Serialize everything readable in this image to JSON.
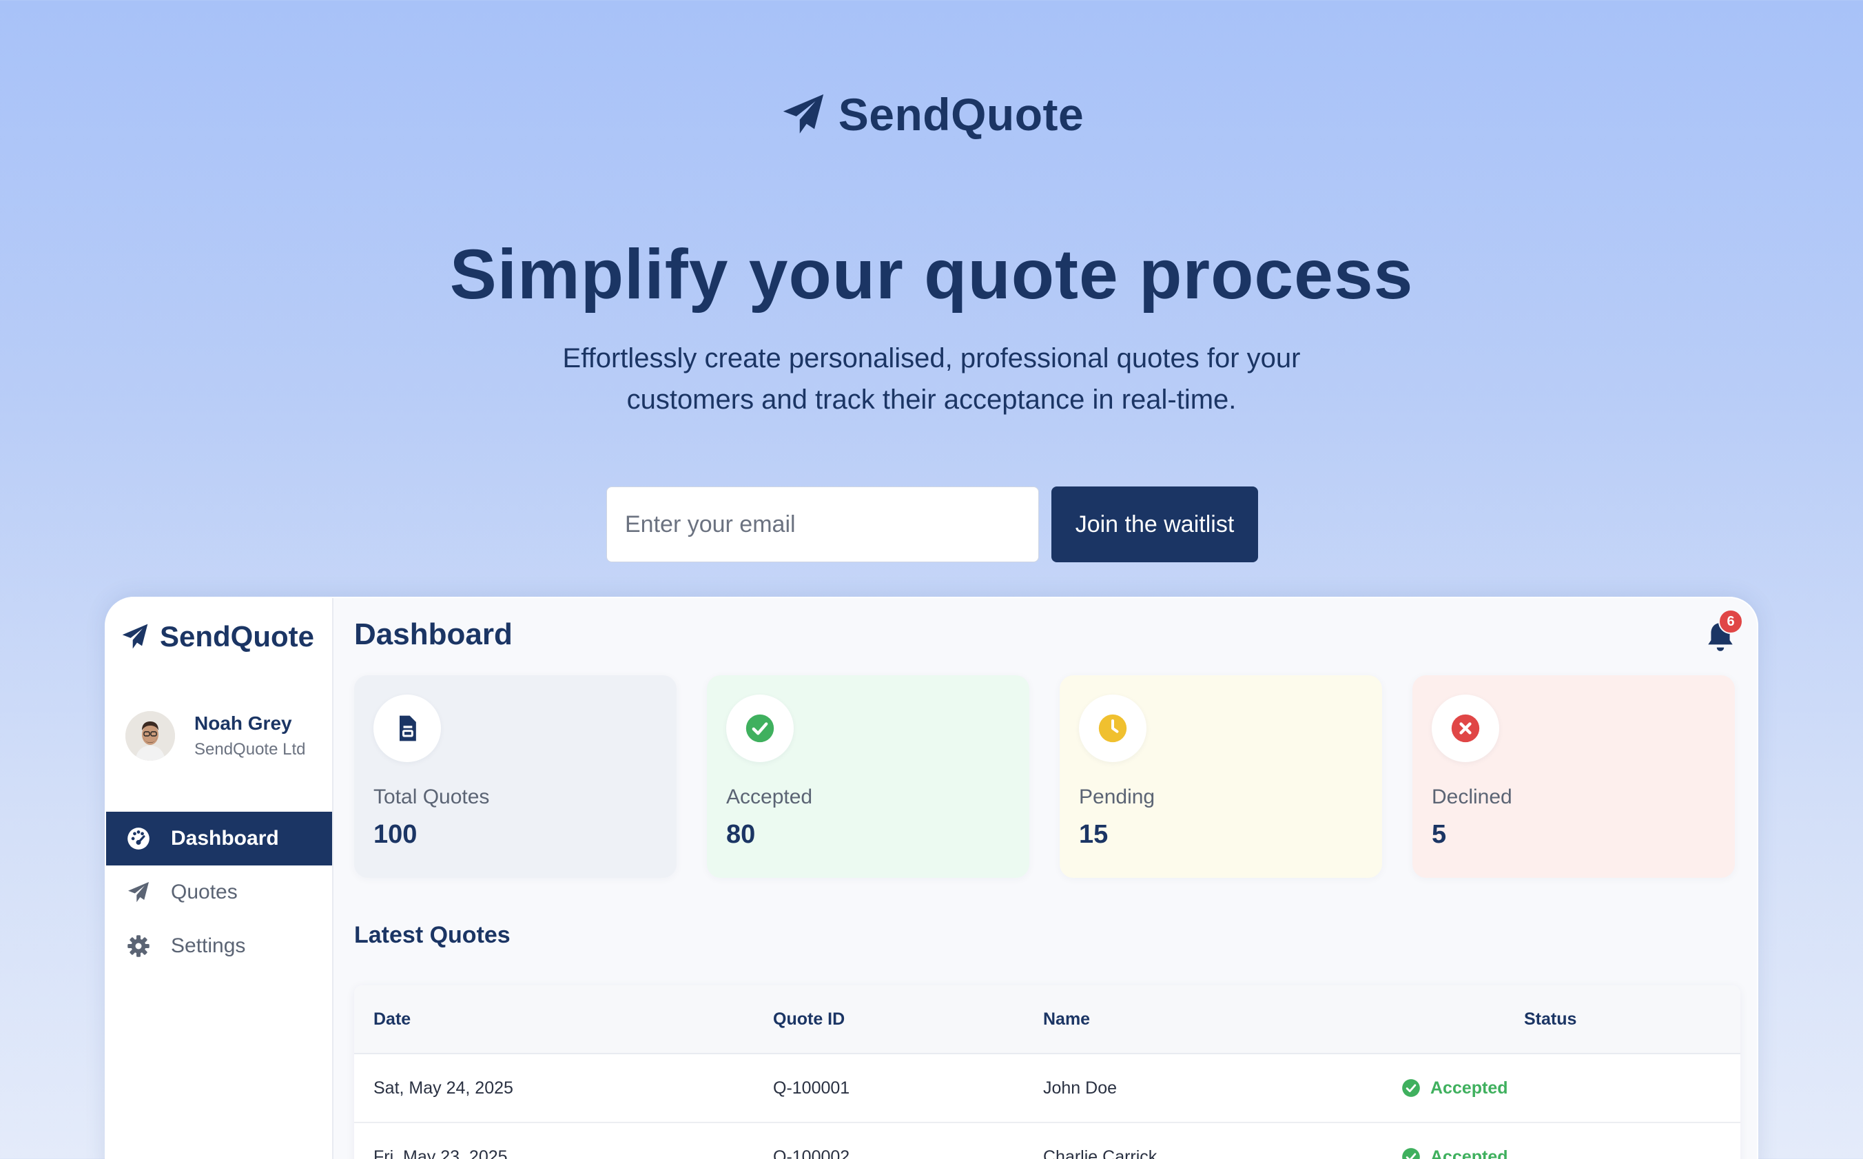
{
  "brand": {
    "name": "SendQuote"
  },
  "hero": {
    "title": "Simplify your quote process",
    "subtitle_line1": "Effortlessly create personalised, professional quotes for your",
    "subtitle_line2": "customers and track their acceptance in real-time."
  },
  "waitlist": {
    "email_placeholder": "Enter your email",
    "button_label": "Join the waitlist"
  },
  "app": {
    "brand_name": "SendQuote",
    "user": {
      "name": "Noah Grey",
      "company": "SendQuote Ltd"
    },
    "nav": [
      {
        "label": "Dashboard",
        "icon": "gauge-icon",
        "active": true
      },
      {
        "label": "Quotes",
        "icon": "paper-plane-icon",
        "active": false
      },
      {
        "label": "Settings",
        "icon": "gear-icon",
        "active": false
      }
    ],
    "page_title": "Dashboard",
    "notifications": {
      "count": "6"
    },
    "stats": [
      {
        "label": "Total Quotes",
        "value": "100",
        "icon": "document-icon",
        "color": "#1b3564"
      },
      {
        "label": "Accepted",
        "value": "80",
        "icon": "check-icon",
        "color": "#3fb05e"
      },
      {
        "label": "Pending",
        "value": "15",
        "icon": "clock-icon",
        "color": "#f0c02f"
      },
      {
        "label": "Declined",
        "value": "5",
        "icon": "x-icon",
        "color": "#e04646"
      }
    ],
    "latest": {
      "title": "Latest Quotes",
      "columns": [
        "Date",
        "Quote ID",
        "Name",
        "Status"
      ],
      "rows": [
        {
          "date": "Sat, May 24, 2025",
          "id": "Q-100001",
          "name": "John Doe",
          "status": "Accepted"
        },
        {
          "date": "Fri, May 23, 2025",
          "id": "Q-100002",
          "name": "Charlie Carrick",
          "status": "Accepted"
        }
      ]
    }
  }
}
